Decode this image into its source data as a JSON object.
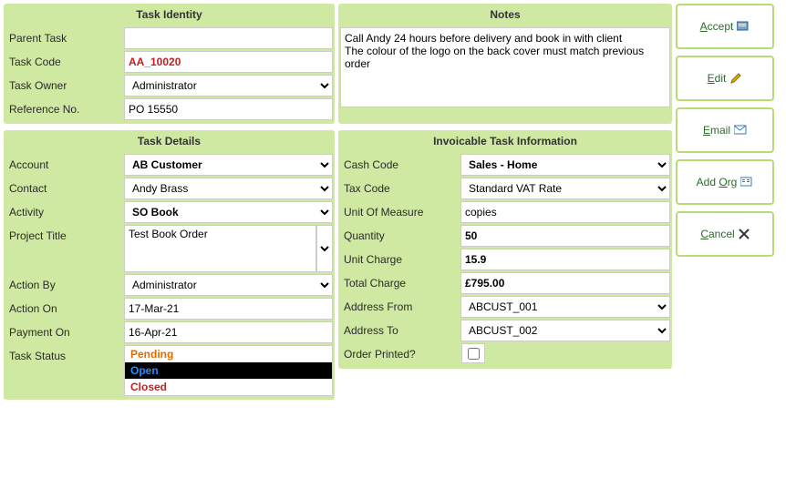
{
  "panels": {
    "identity": {
      "title": "Task Identity"
    },
    "notes": {
      "title": "Notes"
    },
    "details": {
      "title": "Task Details"
    },
    "invoice": {
      "title": "Invoicable Task Information"
    }
  },
  "identity": {
    "parent_task": {
      "label": "Parent Task",
      "value": ""
    },
    "task_code": {
      "label": "Task Code",
      "value": "AA_10020"
    },
    "task_owner": {
      "label": "Task Owner",
      "value": "Administrator"
    },
    "reference_no": {
      "label": "Reference No.",
      "value": "PO 15550"
    }
  },
  "notes": {
    "text": "Call Andy 24 hours before delivery and book in with client\nThe colour of the logo on the back cover must match previous order"
  },
  "details": {
    "account": {
      "label": "Account",
      "value": "AB Customer"
    },
    "contact": {
      "label": "Contact",
      "value": "Andy Brass"
    },
    "activity": {
      "label": "Activity",
      "value": "SO Book"
    },
    "project_title": {
      "label": "Project Title",
      "value": "Test Book Order"
    },
    "action_by": {
      "label": "Action By",
      "value": "Administrator"
    },
    "action_on": {
      "label": "Action On",
      "value": "17-Mar-21"
    },
    "payment_on": {
      "label": "Payment On",
      "value": "16-Apr-21"
    },
    "task_status": {
      "label": "Task Status",
      "options": [
        "Pending",
        "Open",
        "Closed"
      ],
      "selected": "Open"
    }
  },
  "invoice": {
    "cash_code": {
      "label": "Cash Code",
      "value": "Sales - Home"
    },
    "tax_code": {
      "label": "Tax Code",
      "value": "Standard VAT Rate"
    },
    "uom": {
      "label": "Unit Of Measure",
      "value": "copies"
    },
    "quantity": {
      "label": "Quantity",
      "value": "50"
    },
    "unit_charge": {
      "label": "Unit Charge",
      "value": "15.9"
    },
    "total_charge": {
      "label": "Total Charge",
      "value": "£795.00"
    },
    "address_from": {
      "label": "Address From",
      "value": "ABCUST_001"
    },
    "address_to": {
      "label": "Address To",
      "value": "ABCUST_002"
    },
    "order_printed": {
      "label": "Order Printed?",
      "value": false
    }
  },
  "buttons": {
    "accept": "ccept",
    "accept_u": "A",
    "edit": "dit",
    "edit_u": "E",
    "email": "mail",
    "email_u": "E",
    "addorg": "rg",
    "addorg_pre": "Add ",
    "addorg_u": "O",
    "cancel": "ancel",
    "cancel_u": "C"
  }
}
